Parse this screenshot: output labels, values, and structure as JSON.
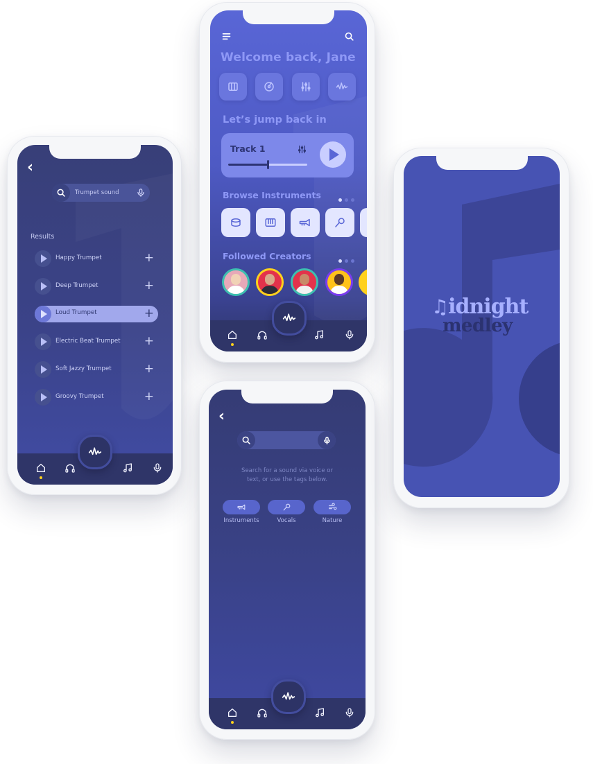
{
  "colors": {
    "accent": "#5966d6",
    "dark_navy": "#2f3568",
    "light_lavender": "#a1a8ec",
    "active_dot": "#ffd11c"
  },
  "results_screen": {
    "search_value": "Trumpet sound",
    "results_label": "Results",
    "results": [
      {
        "name": "Happy Trumpet",
        "active": false
      },
      {
        "name": "Deep Trumpet",
        "active": false
      },
      {
        "name": "Loud Trumpet",
        "active": true
      },
      {
        "name": "Electric Beat Trumpet",
        "active": false
      },
      {
        "name": "Soft Jazzy Trumpet",
        "active": false
      },
      {
        "name": "Groovy Trumpet",
        "active": false
      }
    ]
  },
  "home_screen": {
    "welcome": "Welcome back, Jane",
    "quick_tiles": [
      "piano-keys-icon",
      "record-icon",
      "sliders-icon",
      "waveform-icon"
    ],
    "jump_title": "Let’s jump back in",
    "track": {
      "name": "Track 1",
      "progress": 0.5
    },
    "browse_title": "Browse Instruments",
    "instruments": [
      "drum-icon",
      "keyboard-icon",
      "trumpet-icon",
      "microphone-icon"
    ],
    "followed_title": "Followed Creators",
    "creator_ring_colors": [
      "#3dbfb0",
      "#ffd11c",
      "#3dbfb0",
      "#7a3cf0",
      "#ffd11c"
    ]
  },
  "search_screen": {
    "search_placeholder": "",
    "hint": "Search for a sound via voice or text, or use the tags below.",
    "tags": [
      {
        "label": "Instruments",
        "icon": "trumpet-icon"
      },
      {
        "label": "Vocals",
        "icon": "microphone-icon"
      },
      {
        "label": "Nature",
        "icon": "wind-icon"
      }
    ]
  },
  "splash_screen": {
    "logo_line1": "idnight",
    "logo_line2": "medley"
  },
  "bottom_nav": [
    "home-icon",
    "headphones-icon",
    "waveform-icon",
    "music-note-icon",
    "microphone-icon"
  ]
}
